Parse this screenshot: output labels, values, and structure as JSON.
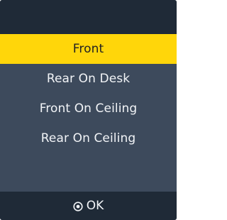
{
  "menu": {
    "items": [
      {
        "label": "Front",
        "selected": true
      },
      {
        "label": "Rear On Desk",
        "selected": false
      },
      {
        "label": "Front On Ceiling",
        "selected": false
      },
      {
        "label": "Rear On Ceiling",
        "selected": false
      }
    ]
  },
  "footer": {
    "ok_label": "OK",
    "ok_icon": "select-circle-icon"
  },
  "colors": {
    "background": "#3d4a5c",
    "bar": "#1f2a37",
    "highlight": "#ffd60a",
    "text": "#f2f4f7",
    "highlight_text": "#222222"
  }
}
